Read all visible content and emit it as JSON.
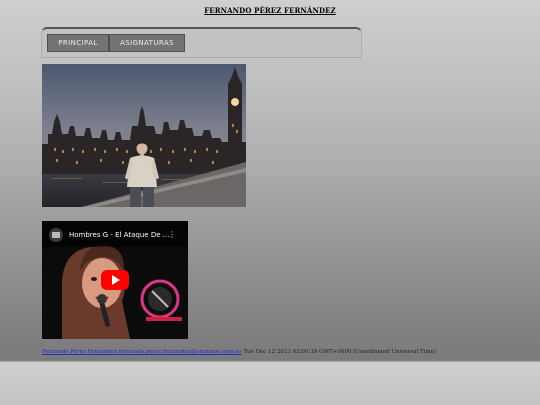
{
  "header": {
    "title": "FERNANDO PÉREZ FERNÁNDEZ"
  },
  "nav": {
    "items": [
      {
        "label": "PRINCIPAL"
      },
      {
        "label": "ASIGNATURAS"
      }
    ]
  },
  "video": {
    "title": "Hombres G - El Ataque De ...",
    "more_icon": "more-vert-icon",
    "play_icon": "youtube-play-icon"
  },
  "footer": {
    "author_link": "Fernando Pérez Fernández fernando.perez.fernandez@alumnos.upm.es",
    "timestamp": "Tue Dec 12 2023 02:00:39 GMT+0000 (Coordinated Universal Time)"
  },
  "colors": {
    "nav_button_bg": "#747474",
    "link": "#1a2bd0",
    "youtube_red": "#ff0000"
  }
}
